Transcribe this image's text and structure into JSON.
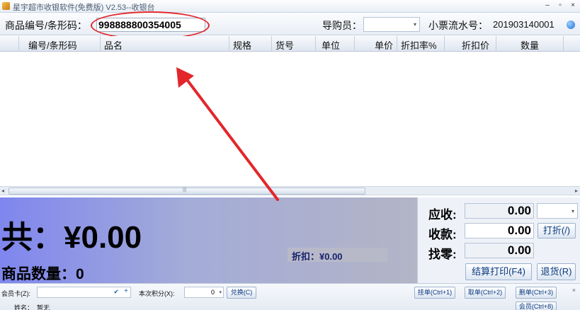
{
  "window": {
    "title": "星宇超市收银软件(免费版) V2.53--收银台",
    "minimize": "–",
    "restore": "▫",
    "close": "×"
  },
  "search": {
    "barcode_label": "商品编号/条形码：",
    "barcode_value": "998888800354005",
    "guide_label": "导购员：",
    "guide_value": "",
    "serial_label": "小票流水号：",
    "serial_value": "201903140001"
  },
  "grid": {
    "columns": [
      "编号/条形码",
      "品名",
      "规格",
      "货号",
      "单位",
      "单价",
      "折扣率%",
      "折扣价",
      "数量"
    ],
    "rows": []
  },
  "totals": {
    "total_label": "共：¥0.00",
    "count_label": "商品数量：0",
    "discount_label": "折扣：¥0.00"
  },
  "payment": {
    "receivable_label": "应收:",
    "receivable_value": "0.00",
    "received_label": "收款:",
    "received_value": "0.00",
    "change_label": "找零:",
    "change_value": "0.00",
    "discount_button": "打折(/)",
    "settle_button": "结算打印(F4)",
    "return_button": "退货(R)",
    "paytype_value": ""
  },
  "bottom": {
    "member_label": "会员卡(Z):",
    "member_value": "",
    "points_label": "本次积分(X):",
    "points_value": "0",
    "redeem_button": "兑换(C)",
    "name_label": "姓名：",
    "name_value": "暂无",
    "hold_button": "挂单(Ctrl+1)",
    "retrieve_button": "取单(Ctrl+2)",
    "delete_button": "删单(Ctrl+3)",
    "select_button": "会员(Ctrl+8)"
  },
  "colors": {
    "accent_blue": "#7f86ee",
    "annotation_red": "#e3262b",
    "discount_text": "#15206b"
  }
}
